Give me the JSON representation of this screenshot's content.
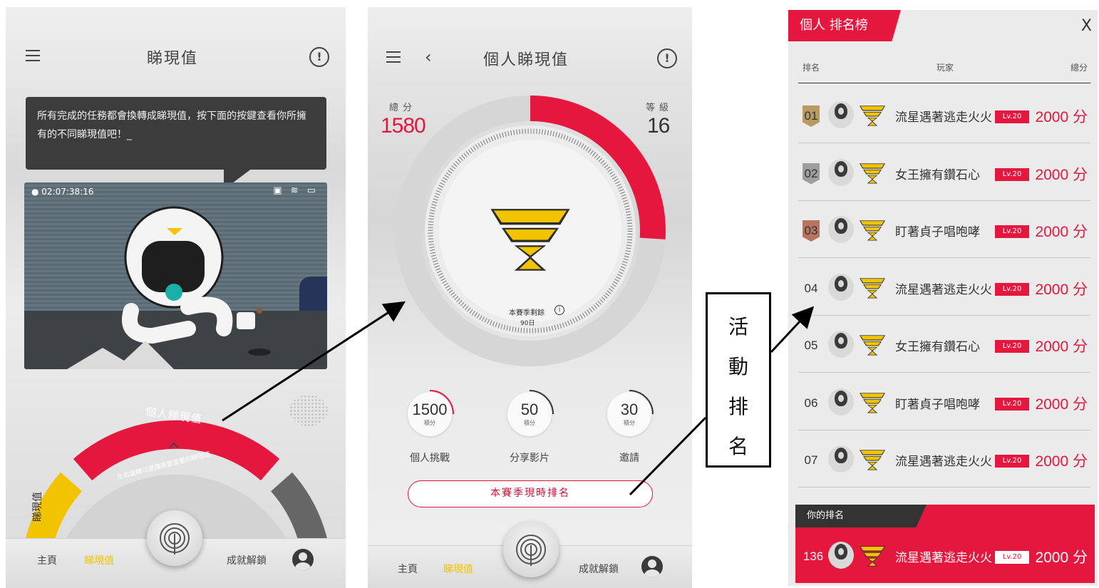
{
  "screen1": {
    "title": "睇現值",
    "bubble_text": "所有完成的任務都會換轉成睇現值，按下面的按鍵查看你所擁有的不同睇現值吧！_",
    "status_time": "02:07:38:16",
    "dial_label": "個人睇現值",
    "dial_left_label": "睇現值",
    "dial_hint": "左右旋轉以選擇需要查看的睇現值",
    "tabs": [
      "主頁",
      "睇現值",
      "成就解鎖"
    ],
    "active_tab": "睇現值"
  },
  "screen2": {
    "title": "個人睇現值",
    "total_label": "總分",
    "total_value": "1580",
    "level_label": "等級",
    "level_value": "16",
    "season_label": "本賽季剩餘",
    "season_days": "90日",
    "level_progress": 0.26,
    "stats": [
      {
        "value": "1500",
        "unit": "積分",
        "label": "個人挑戰"
      },
      {
        "value": "50",
        "unit": "積分",
        "label": "分享影片"
      },
      {
        "value": "30",
        "unit": "積分",
        "label": "邀請"
      }
    ],
    "season_rank_button": "本賽季現時排名",
    "tabs": [
      "主頁",
      "睇現值",
      "成就解鎖"
    ],
    "active_tab": "睇現值"
  },
  "annotation": {
    "chars": [
      "活",
      "動",
      "排",
      "名"
    ]
  },
  "screen3": {
    "tab_title": "個人 排名榜",
    "close": "X",
    "headers": {
      "rank": "排名",
      "player": "玩家",
      "score": "總分"
    },
    "rows": [
      {
        "rank": "01",
        "name": "流星遇著逃走火火",
        "lv": "Lv.20",
        "score": "2000 分"
      },
      {
        "rank": "02",
        "name": "女王擁有鑽石心",
        "lv": "Lv.20",
        "score": "2000 分"
      },
      {
        "rank": "03",
        "name": "盯著貞子唱咆哮",
        "lv": "Lv.20",
        "score": "2000 分"
      },
      {
        "rank": "04",
        "name": "流星遇著逃走火火",
        "lv": "Lv.20",
        "score": "2000 分"
      },
      {
        "rank": "05",
        "name": "女王擁有鑽石心",
        "lv": "Lv.20",
        "score": "2000 分"
      },
      {
        "rank": "06",
        "name": "盯著貞子唱咆哮",
        "lv": "Lv.20",
        "score": "2000 分"
      },
      {
        "rank": "07",
        "name": "流星遇著逃走火火",
        "lv": "Lv.20",
        "score": "2000 分"
      }
    ],
    "my_rank_label": "你的排名",
    "my_rank": {
      "rank": "136",
      "name": "流星遇著逃走火火",
      "lv": "Lv.20",
      "score": "2000 分"
    }
  },
  "colors": {
    "accent_red": "#e5173f",
    "accent_yellow": "#f2c300",
    "dark": "#3c3c3c"
  }
}
